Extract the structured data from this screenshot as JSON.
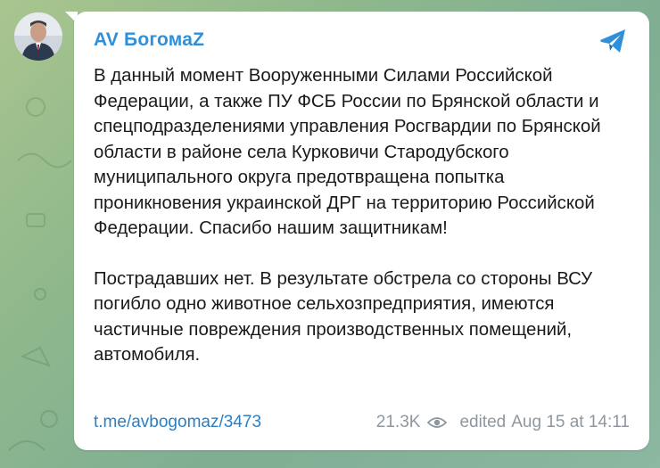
{
  "message": {
    "author": "AV БогомаZ",
    "paragraph1": "В данный момент Вооруженными Силами Российской Федерации, а также ПУ ФСБ России по Брянской области и спецподразделениями управления Росгвардии по Брянской области в районе села Курковичи Стародубского муниципального округа предотвращена попытка проникновения украинской ДРГ на территорию Российской Федерации. Спасибо нашим защитникам!",
    "paragraph2": "Пострадавших нет. В результате обстрела со стороны ВСУ погибло одно животное сельхозпредприятия, имеются частичные повреждения производственных помещений, автомобиля.",
    "link": "t.me/avbogomaz/3473",
    "views": "21.3K",
    "edited_label": "edited",
    "timestamp": "Aug 15 at 14:11"
  },
  "icons": {
    "share": "telegram-plane-icon",
    "views": "eye-icon",
    "avatar": "avatar"
  },
  "colors": {
    "author": "#2f8fd8",
    "link": "#2a7fc4",
    "meta": "#8e979f",
    "share": "#2f8fd8"
  }
}
